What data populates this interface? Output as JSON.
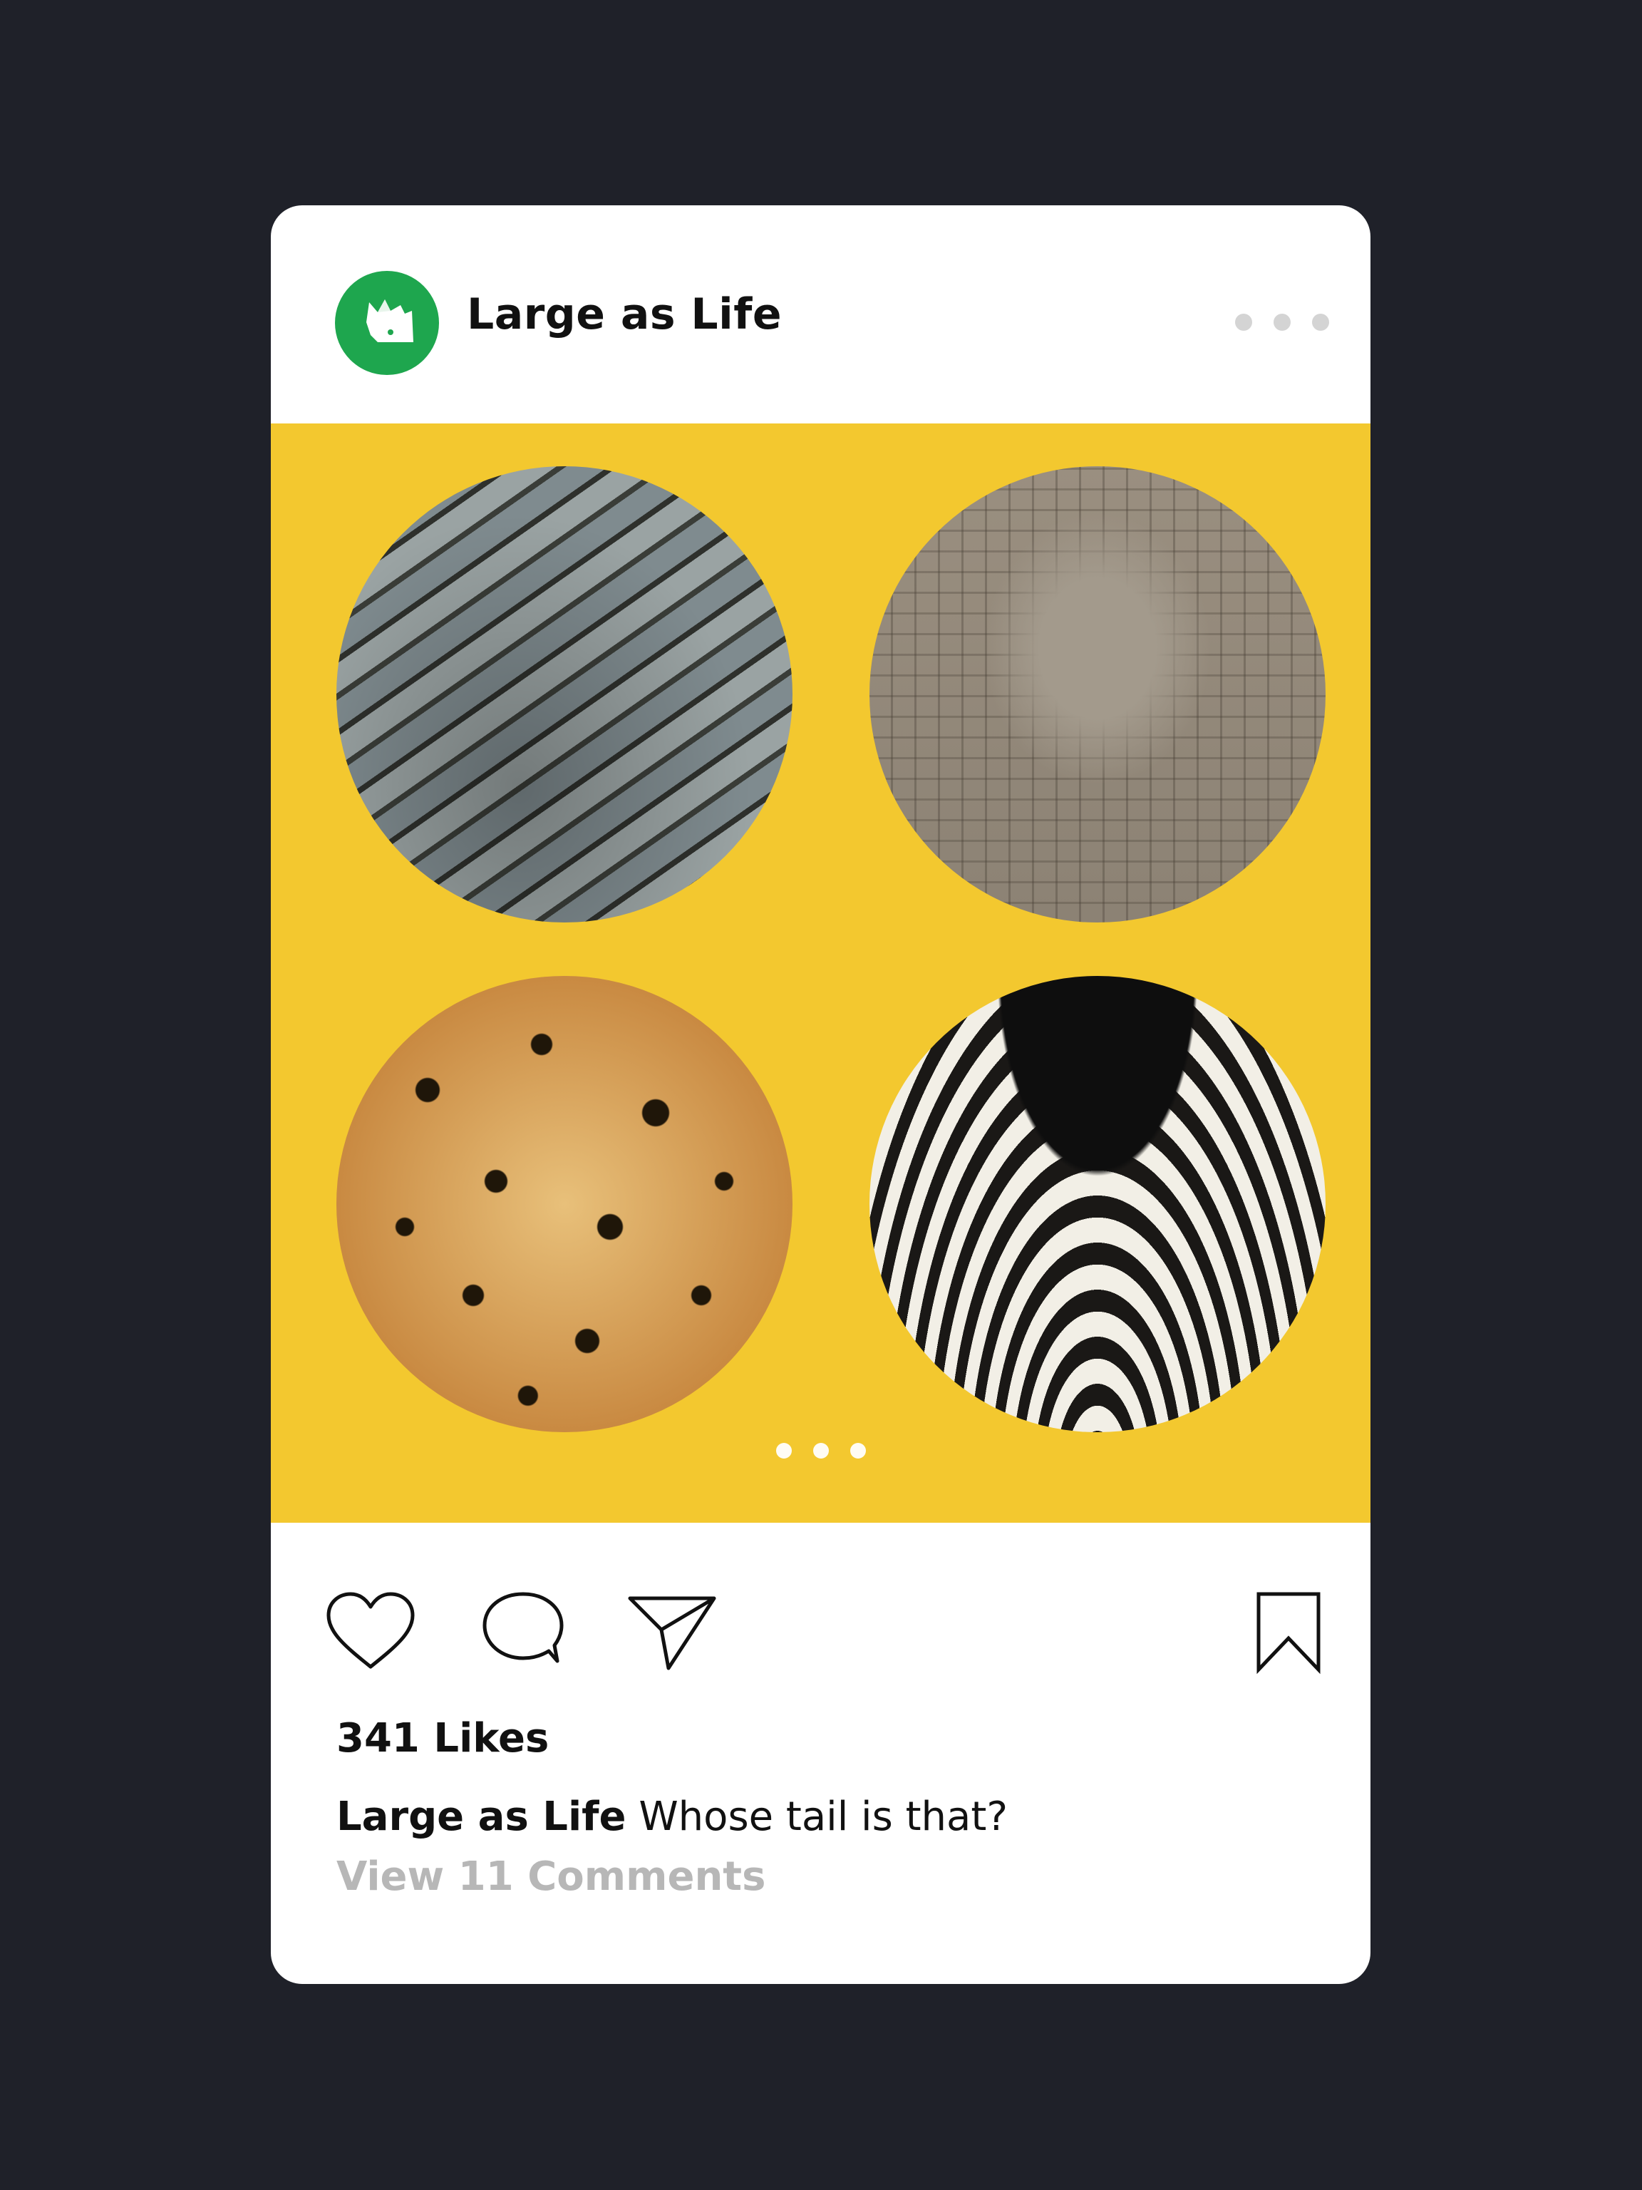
{
  "post": {
    "account_name": "Large as Life",
    "avatar_icon": "rhino-icon",
    "avatar_color": "#1ea64e",
    "media_background": "#f3c82f",
    "images": [
      "crocodile-tail",
      "elephant-tail",
      "leopard-tail",
      "zebra-tail"
    ],
    "carousel_dots": 3,
    "likes": "341 Likes",
    "caption_user": "Large as Life",
    "caption_text": "Whose tail is that?",
    "view_comments": "View 11 Comments"
  },
  "actions": {
    "like_icon": "heart-icon",
    "comment_icon": "comment-icon",
    "share_icon": "send-icon",
    "save_icon": "bookmark-icon"
  }
}
